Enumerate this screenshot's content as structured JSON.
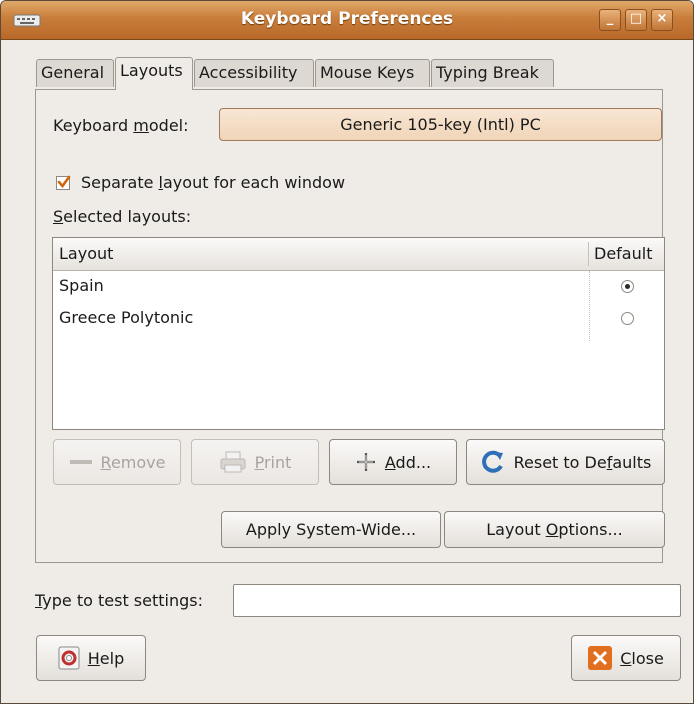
{
  "window": {
    "title": "Keyboard Preferences",
    "controls": {
      "minimize": "_",
      "maximize": "□",
      "close": "×"
    }
  },
  "tabs": [
    {
      "label": "General",
      "active": false
    },
    {
      "label": "Layouts",
      "active": true
    },
    {
      "label": "Accessibility",
      "active": false
    },
    {
      "label": "Mouse Keys",
      "active": false
    },
    {
      "label": "Typing Break",
      "active": false
    }
  ],
  "layouts": {
    "model_label_pre": "Keyboard ",
    "model_label_u": "m",
    "model_label_post": "odel:",
    "model_value": "Generic 105-key (Intl) PC",
    "separate_label_pre": "Separate ",
    "separate_label_u": "l",
    "separate_label_post": "ayout for each window",
    "separate_checked": true,
    "selected_label_u": "S",
    "selected_label_post": "elected layouts:",
    "columns": {
      "layout": "Layout",
      "default": "Default"
    },
    "rows": [
      {
        "name": "Spain",
        "default": true
      },
      {
        "name": "Greece Polytonic",
        "default": false
      }
    ],
    "buttons": {
      "remove_u": "R",
      "remove_post": "emove",
      "print_u": "P",
      "print_post": "rint",
      "add_u": "A",
      "add_post": "dd...",
      "reset_pre": "Reset to De",
      "reset_u": "f",
      "reset_post": "aults",
      "apply": "Apply System-Wide...",
      "options_pre": "Layout ",
      "options_u": "O",
      "options_post": "ptions..."
    }
  },
  "test": {
    "label_u": "T",
    "label_post": "ype to test settings:",
    "value": ""
  },
  "footer": {
    "help_u": "H",
    "help_post": "elp",
    "close_u": "C",
    "close_post": "lose"
  },
  "icons": [
    "keyboard-icon",
    "check-icon",
    "minus-icon",
    "printer-icon",
    "plus-icon",
    "reset-icon",
    "help-icon",
    "close-icon"
  ],
  "colors": {
    "titlebar": "#c97d3a",
    "accent": "#e07020",
    "window_bg": "#efebe7"
  }
}
